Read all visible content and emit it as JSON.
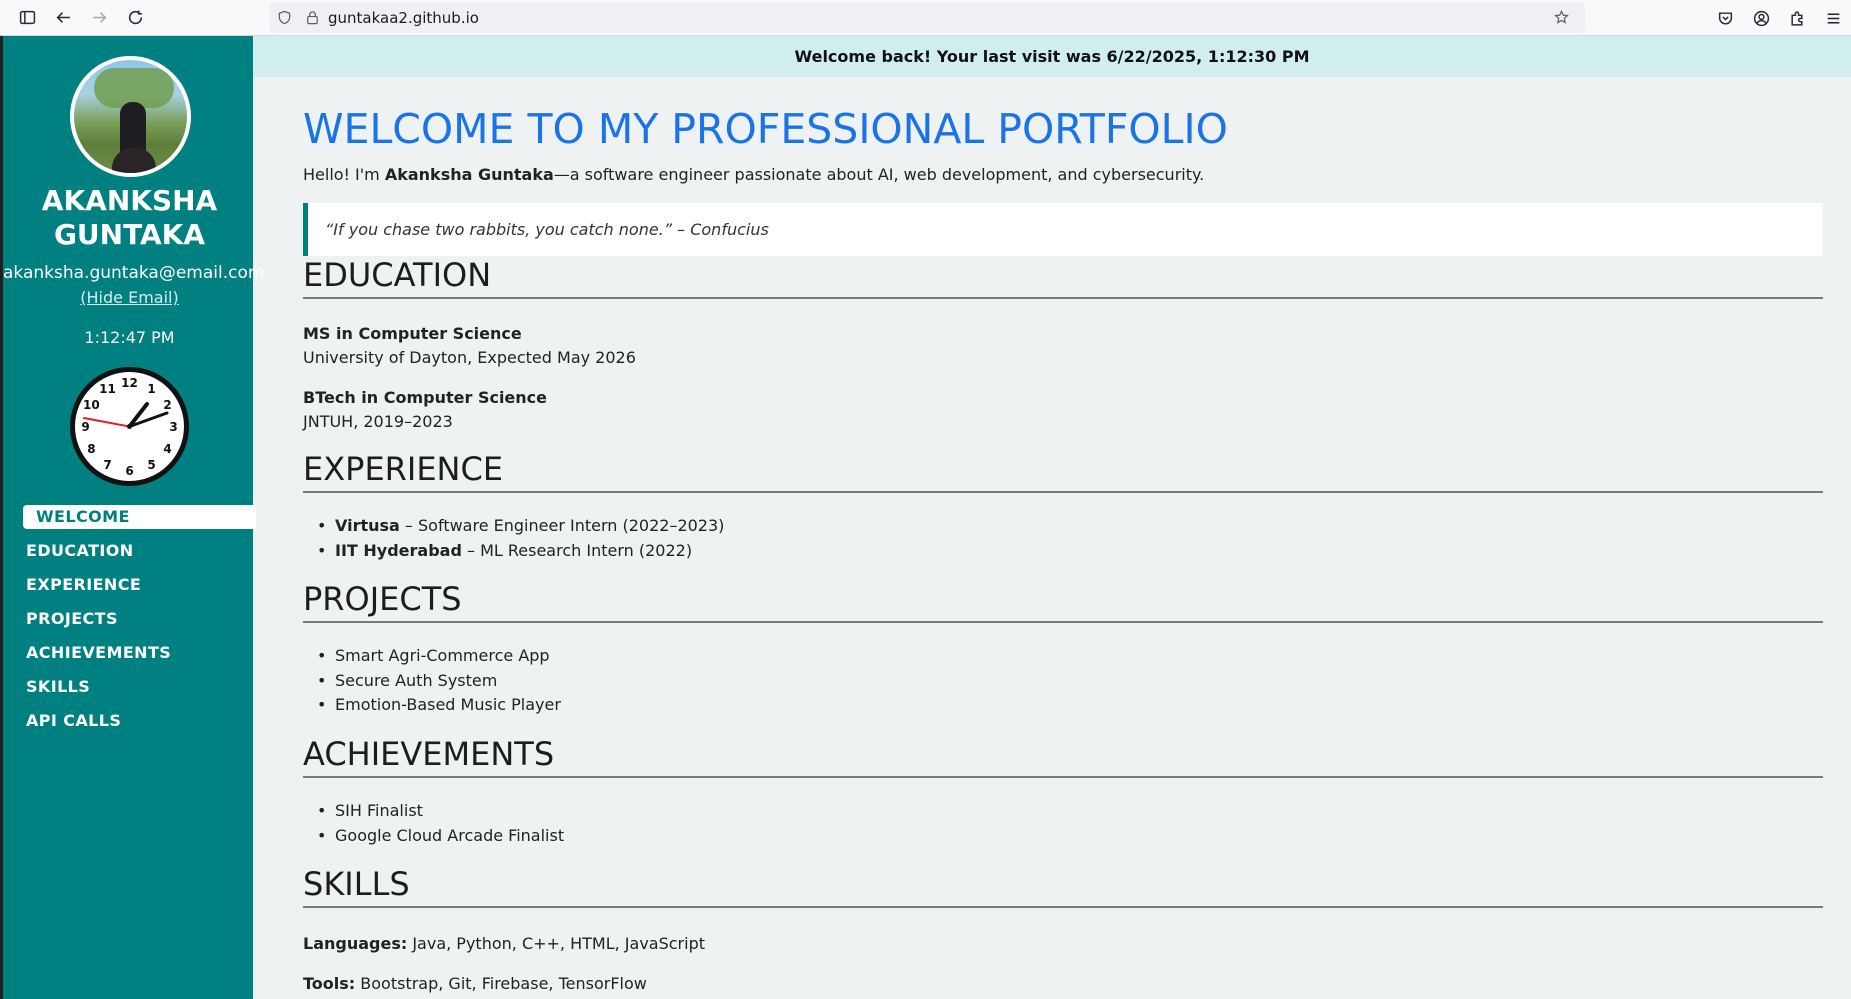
{
  "browser": {
    "url": "guntakaa2.github.io"
  },
  "banner": {
    "text": "Welcome back! Your last visit was 6/22/2025, 1:12:30 PM"
  },
  "sidebar": {
    "name": "AKANKSHA GUNTAKA",
    "email": "akanksha.guntaka@email.com",
    "hide_email": "(Hide Email)",
    "time": "1:12:47 PM",
    "clock_numbers": [
      "12",
      "1",
      "2",
      "3",
      "4",
      "5",
      "6",
      "7",
      "8",
      "9",
      "10",
      "11"
    ],
    "nav": [
      {
        "label": "WELCOME",
        "active": true
      },
      {
        "label": "EDUCATION",
        "active": false
      },
      {
        "label": "EXPERIENCE",
        "active": false
      },
      {
        "label": "PROJECTS",
        "active": false
      },
      {
        "label": "ACHIEVEMENTS",
        "active": false
      },
      {
        "label": "SKILLS",
        "active": false
      },
      {
        "label": "API CALLS",
        "active": false
      }
    ]
  },
  "welcome": {
    "title": "WELCOME TO MY PROFESSIONAL PORTFOLIO",
    "intro_prefix": "Hello! I'm ",
    "intro_name": "Akanksha Guntaka",
    "intro_suffix": "—a software engineer passionate about AI, web development, and cybersecurity.",
    "quote": "“If you chase two rabbits, you catch none.” – Confucius"
  },
  "education": {
    "heading": "EDUCATION",
    "items": [
      {
        "degree": "MS in Computer Science",
        "detail": "University of Dayton, Expected May 2026"
      },
      {
        "degree": "BTech in Computer Science",
        "detail": "JNTUH, 2019–2023"
      }
    ]
  },
  "experience": {
    "heading": "EXPERIENCE",
    "items": [
      {
        "org": "Virtusa",
        "role": " – Software Engineer Intern (2022–2023)"
      },
      {
        "org": "IIT Hyderabad",
        "role": " – ML Research Intern (2022)"
      }
    ]
  },
  "projects": {
    "heading": "PROJECTS",
    "items": [
      "Smart Agri-Commerce App",
      "Secure Auth System",
      "Emotion-Based Music Player"
    ]
  },
  "achievements": {
    "heading": "ACHIEVEMENTS",
    "items": [
      "SIH Finalist",
      "Google Cloud Arcade Finalist"
    ]
  },
  "skills": {
    "heading": "SKILLS",
    "languages_label": "Languages:",
    "languages": " Java, Python, C++, HTML, JavaScript",
    "tools_label": "Tools:",
    "tools": " Bootstrap, Git, Firebase, TensorFlow"
  }
}
